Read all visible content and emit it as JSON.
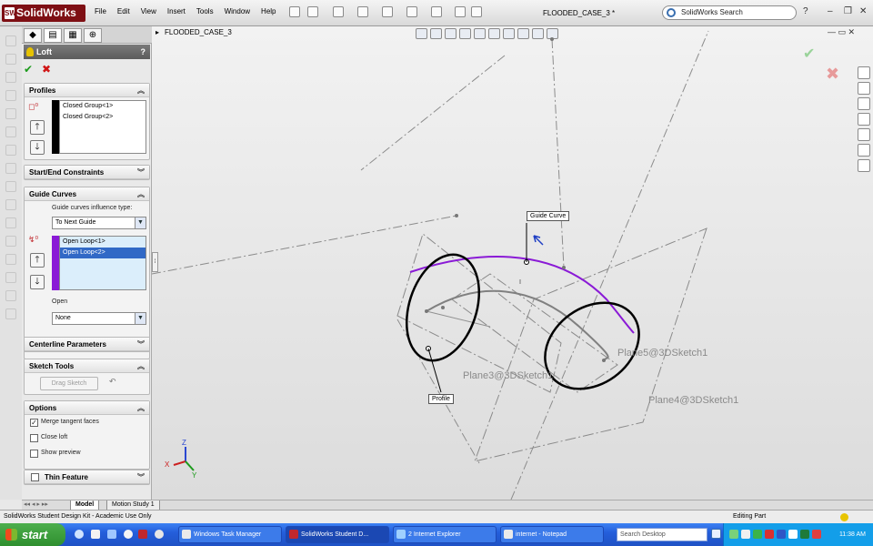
{
  "app": {
    "name": "SolidWorks",
    "logo_mark": "SW",
    "menus": [
      "File",
      "Edit",
      "View",
      "Insert",
      "Tools",
      "Window",
      "Help"
    ],
    "document_title": "FLOODED_CASE_3 *",
    "search_placeholder": "SolidWorks Search",
    "help_label": "?",
    "window_controls": [
      "–",
      "❐",
      "✕"
    ]
  },
  "property_manager": {
    "title": "Loft",
    "help": "?",
    "ok": "✔",
    "cancel": "✖",
    "profiles": {
      "title": "Profiles",
      "items": [
        "Closed Group<1>",
        "Closed Group<2>"
      ]
    },
    "start_end": {
      "title": "Start/End Constraints"
    },
    "guide_curves": {
      "title": "Guide Curves",
      "influence_label": "Guide curves influence type:",
      "influence_value": "To Next Guide",
      "items": [
        "Open Loop<1>",
        "Open Loop<2>"
      ],
      "selected_index": 1,
      "open_label": "Open",
      "open_value": "None"
    },
    "centerline": {
      "title": "Centerline Parameters"
    },
    "sketch_tools": {
      "title": "Sketch Tools",
      "drag_sketch": "Drag Sketch",
      "undo_icon": "↶"
    },
    "options": {
      "title": "Options",
      "merge_tangent": {
        "label": "Merge tangent faces",
        "checked": true
      },
      "close_loft": {
        "label": "Close loft",
        "checked": false
      },
      "show_preview": {
        "label": "Show preview",
        "checked": false
      }
    },
    "thin_feature": {
      "title": "Thin Feature",
      "checked": false
    },
    "colors": {
      "profile_bar": "#000000",
      "guide_bar": "#8a1ad6"
    }
  },
  "viewport": {
    "tree_title": "FLOODED_CASE_3",
    "callouts": {
      "guide_curve": "Guide Curve",
      "profile": "Profile"
    },
    "plane_labels": [
      "Plane3@3DSketch1",
      "Plane5@3DSketch1",
      "Plane4@3DSketch1"
    ],
    "axis_labels": {
      "x": "X",
      "y": "Y",
      "z": "Z"
    },
    "colors": {
      "guide": "#8a1ad6",
      "profile": "#000000",
      "path": "#808080"
    }
  },
  "bottom_tabs": [
    "Model",
    "Motion Study 1"
  ],
  "status": {
    "left": "SolidWorks Student Design Kit - Academic Use Only",
    "right": "Editing Part"
  },
  "taskbar": {
    "start": "start",
    "tasks": [
      "Windows Task Manager",
      "SolidWorks Student D...",
      "2 Internet Explorer",
      "internet - Notepad"
    ],
    "desktop_search": "Search Desktop",
    "clock": "11:38 AM"
  }
}
